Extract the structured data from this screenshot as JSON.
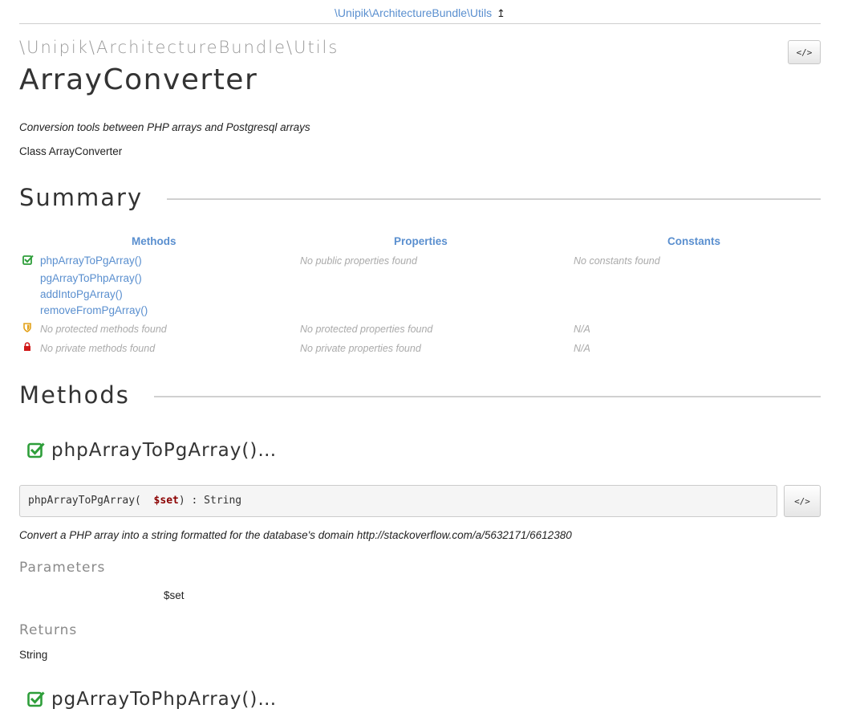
{
  "breadcrumb": {
    "path": "\\Unipik\\ArchitectureBundle\\Utils",
    "up_icon": "↥"
  },
  "header": {
    "namespace": "\\Unipik\\ArchitectureBundle\\Utils",
    "class_name": "ArrayConverter",
    "source_button": "</>"
  },
  "description": "Conversion tools between PHP arrays and Postgresql arrays",
  "class_line": "Class ArrayConverter",
  "summary": {
    "title": "Summary",
    "columns": {
      "methods": "Methods",
      "properties": "Properties",
      "constants": "Constants"
    },
    "public_methods": [
      "phpArrayToPgArray()",
      "pgArrayToPhpArray()",
      "addIntoPgArray()",
      "removeFromPgArray()"
    ],
    "public_properties": "No public properties found",
    "constants": "No constants found",
    "protected_methods": "No protected methods found",
    "protected_properties": "No protected properties found",
    "protected_constants": "N/A",
    "private_methods": "No private methods found",
    "private_properties": "No private properties found",
    "private_constants": "N/A"
  },
  "methods_section": {
    "title": "Methods",
    "items": [
      {
        "title": "phpArrayToPgArray()…",
        "signature_prefix": "phpArrayToPgArray(",
        "signature_param": "$set",
        "signature_suffix": ") : String",
        "description": "Convert a PHP array into a string formatted for the database's domain http://stackoverflow.com/a/5632171/6612380",
        "parameters_label": "Parameters",
        "param_name": "$set",
        "returns_label": "Returns",
        "return_type": "String",
        "source_button": "</>"
      },
      {
        "title": "pgArrayToPhpArray()…"
      }
    ]
  },
  "colors": {
    "link": "#5a8fcf",
    "public": "#2e9e3a",
    "protected": "#e3a21a",
    "private": "#d01818",
    "param": "#8b0000"
  },
  "icons": {
    "public": "check-square-icon",
    "protected": "shield-icon",
    "private": "lock-icon",
    "code": "code-icon",
    "up": "arrow-up-icon"
  }
}
